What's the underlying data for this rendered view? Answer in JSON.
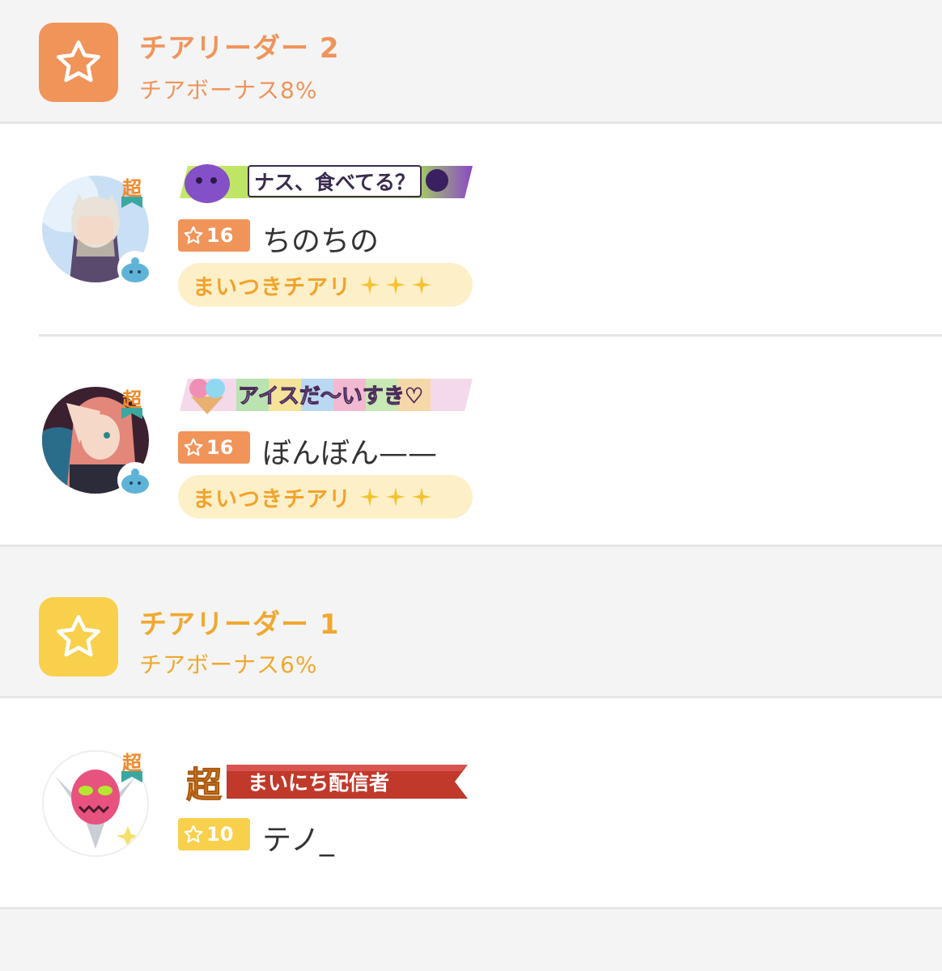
{
  "tiers": [
    {
      "title": "チアリーダー 2",
      "bonus": "チアボーナス8%",
      "color": "#f0945a",
      "icon": "star-outline-icon",
      "members": [
        {
          "banner": "ナス、食べてる？",
          "level": "16",
          "name": "ちのちの",
          "subscription": "まいつきチアリ",
          "super_mark": "超"
        },
        {
          "banner": "アイスだ〜いすき♡",
          "level": "16",
          "name": "ぼんぼん——",
          "subscription": "まいつきチアリ",
          "super_mark": "超"
        }
      ]
    },
    {
      "title": "チアリーダー 1",
      "bonus": "チアボーナス6%",
      "color": "#f8d04c",
      "text_color": "#f0a830",
      "icon": "star-outline-icon",
      "members": [
        {
          "banner_prefix": "超",
          "banner": "まいにち配信者",
          "level": "10",
          "name": "テノ_",
          "super_mark": "超"
        }
      ]
    }
  ]
}
